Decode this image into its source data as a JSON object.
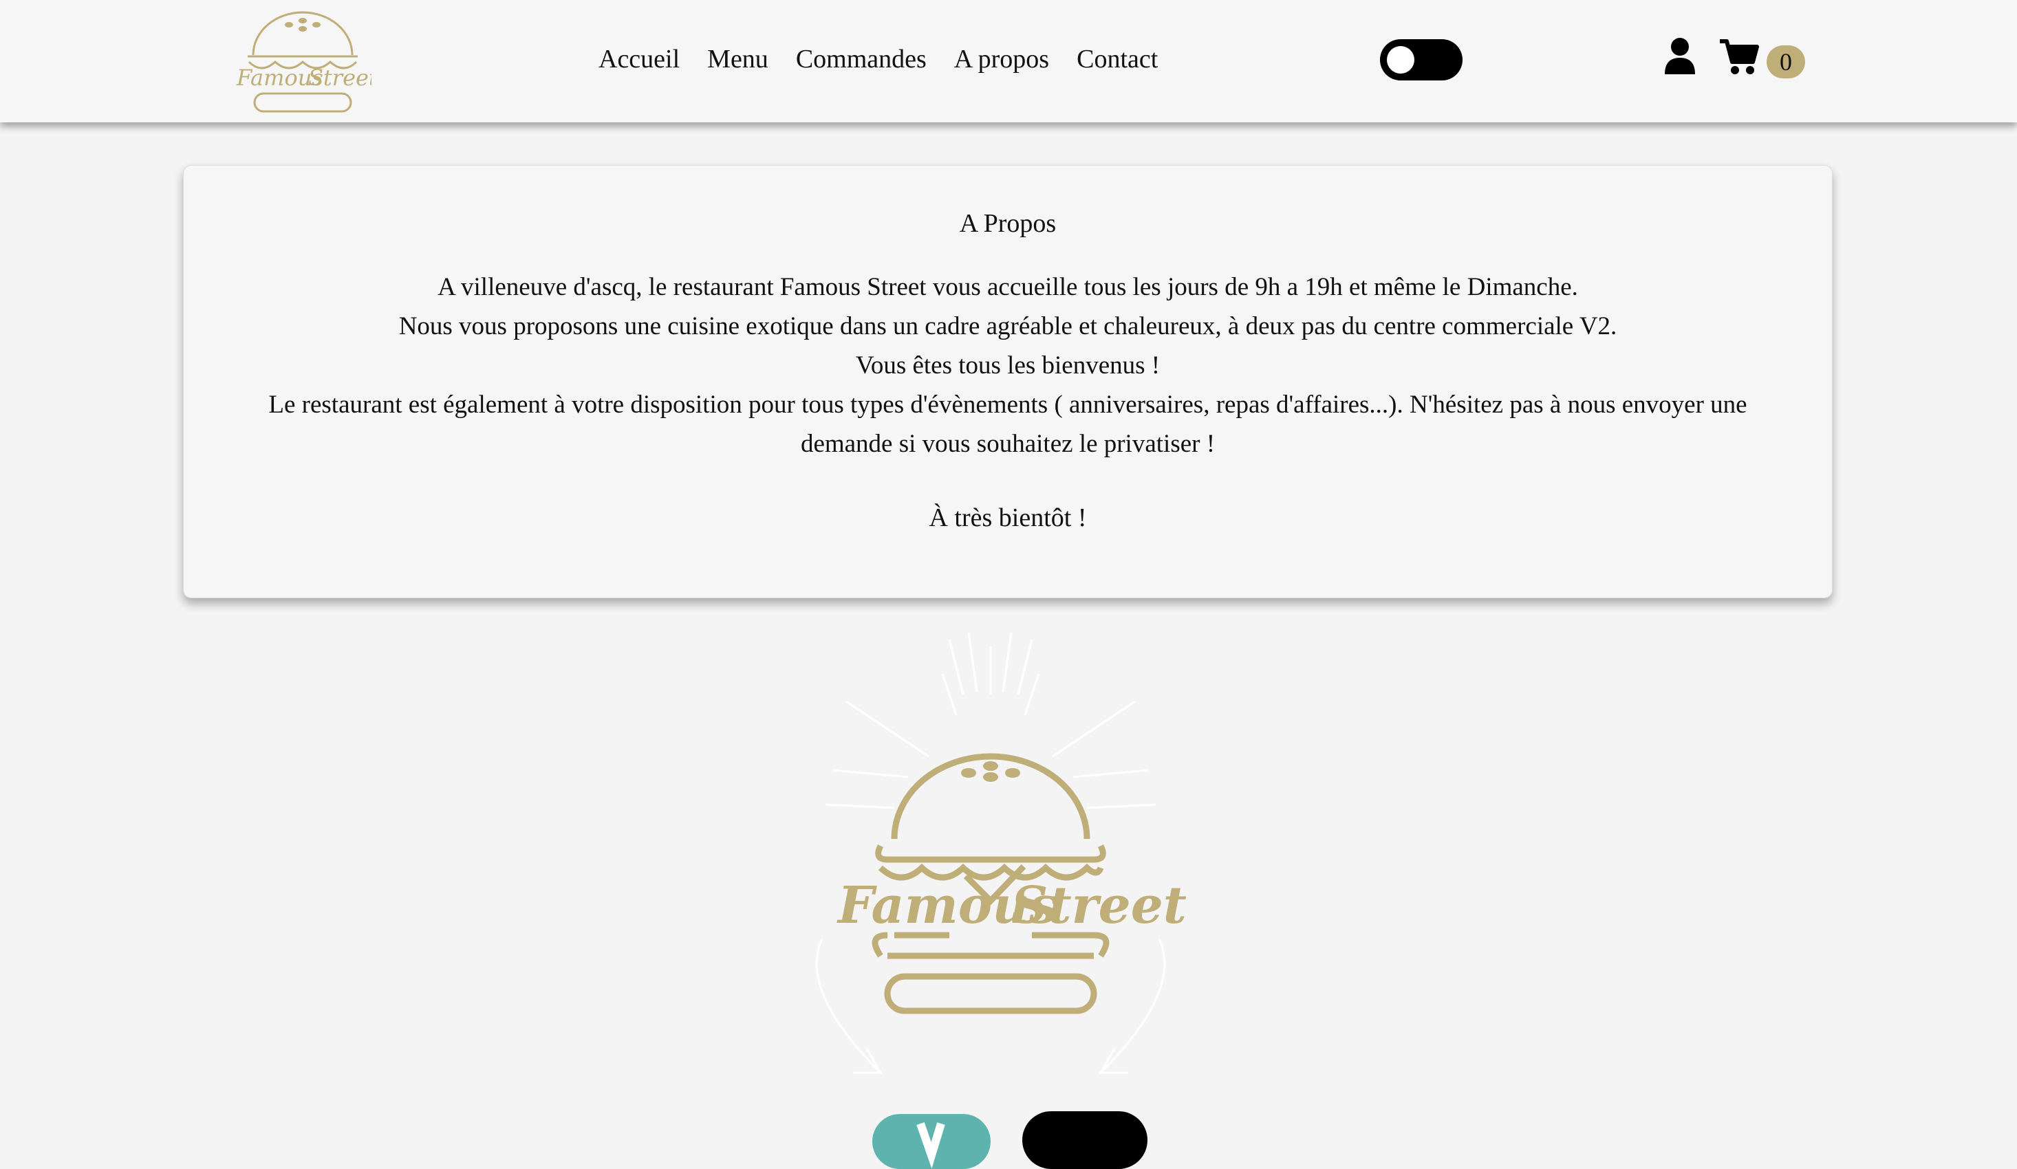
{
  "brand": {
    "logo_line1": "Famous",
    "logo_line2": "Street",
    "gold": "#bfae78"
  },
  "nav": {
    "links": [
      "Accueil",
      "Menu",
      "Commandes",
      "A propos",
      "Contact"
    ]
  },
  "header": {
    "theme_toggle": "toggle-switch",
    "user_icon": "user-icon",
    "cart_icon": "cart-icon",
    "cart_count": "0"
  },
  "about": {
    "title": "A Propos",
    "paragraphs": [
      "A villeneuve d'ascq, le restaurant Famous Street vous accueille tous les jours de 9h a 19h et même le Dimanche.",
      "Nous vous proposons une cuisine exotique dans un cadre agréable et chaleureux, à deux pas du centre commerciale V2.",
      "Vous êtes tous les bienvenus !",
      "Le restaurant est également à votre disposition pour tous types d'évènements ( anniversaires, repas d'affaires...). N'hésitez pas à nous envoyer une demande si vous souhaitez le privatiser !"
    ],
    "closing": "À très bientôt !"
  },
  "colors": {
    "background": "#f4f4f4",
    "card": "#f6f6f6",
    "accent_teal": "#5fb3ae"
  }
}
